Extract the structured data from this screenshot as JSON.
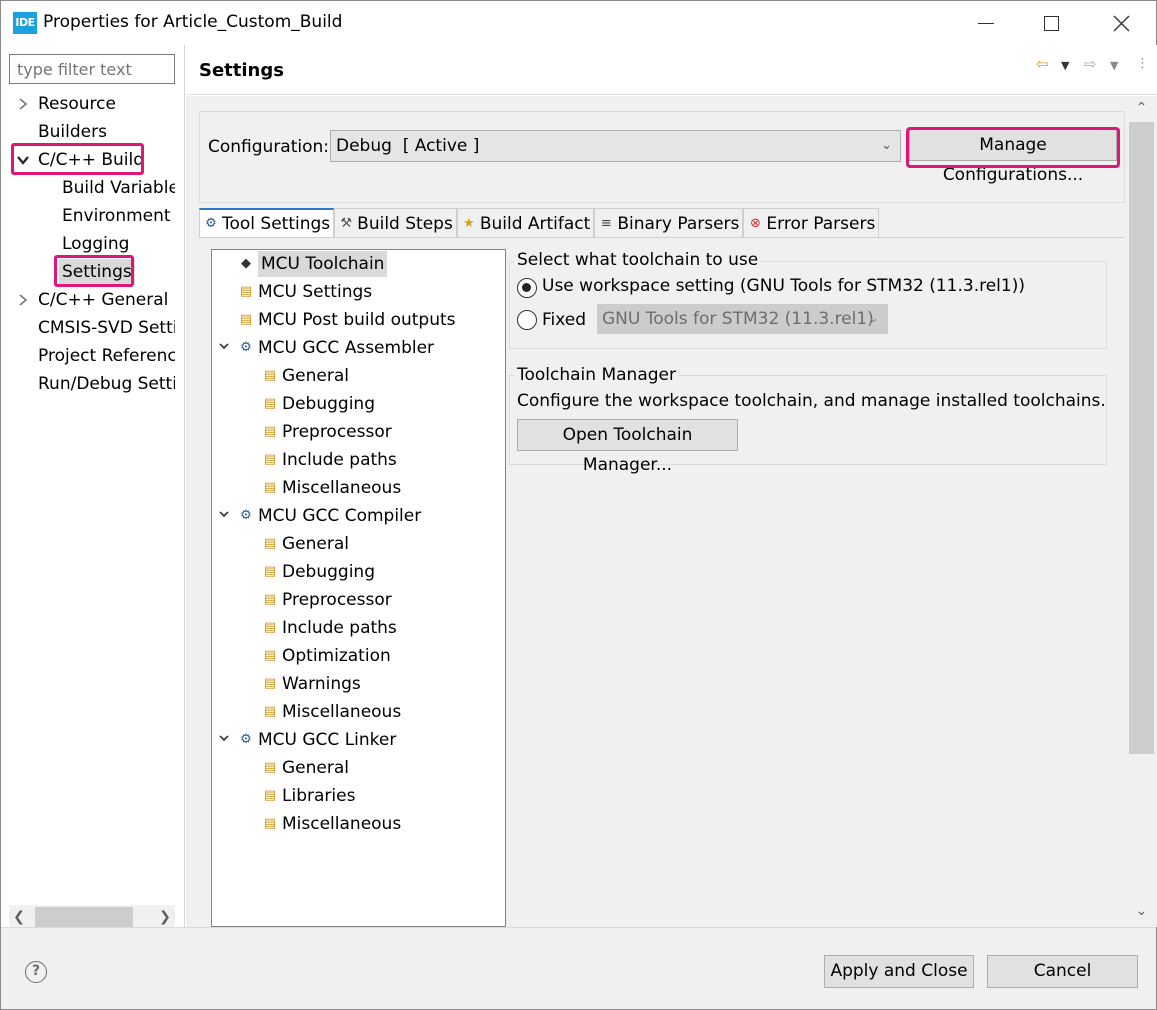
{
  "window": {
    "app_icon": "IDE",
    "title": "Properties for Article_Custom_Build",
    "icons": [
      "minimize-icon",
      "maximize-icon",
      "close-icon"
    ]
  },
  "nav": {
    "filter_placeholder": "type filter text",
    "items": [
      {
        "label": "Resource",
        "twisty": "collapsed"
      },
      {
        "label": "Builders"
      },
      {
        "label": "C/C++ Build",
        "twisty": "expanded",
        "highlighted": true
      },
      {
        "label": "Build Variables"
      },
      {
        "label": "Environment"
      },
      {
        "label": "Logging"
      },
      {
        "label": "Settings",
        "selected": true,
        "highlighted": true
      },
      {
        "label": "C/C++ General",
        "twisty": "collapsed"
      },
      {
        "label": "CMSIS-SVD Settings"
      },
      {
        "label": "Project References"
      },
      {
        "label": "Run/Debug Settings"
      }
    ]
  },
  "panel": {
    "title": "Settings",
    "configuration_label": "Configuration:",
    "configuration_value": "Debug  [ Active ]",
    "manage_button": "Manage Configurations..."
  },
  "tabs": [
    {
      "label": "Tool Settings",
      "icon": "gear-icon",
      "active": true
    },
    {
      "label": "Build Steps",
      "icon": "hammer-icon"
    },
    {
      "label": "Build Artifact",
      "icon": "trophy-icon"
    },
    {
      "label": "Binary Parsers",
      "icon": "binary-icon"
    },
    {
      "label": "Error Parsers",
      "icon": "error-icon"
    }
  ],
  "tree": [
    {
      "label": "MCU Toolchain",
      "level": 0,
      "icon": "chip",
      "selected": true
    },
    {
      "label": "MCU Settings",
      "level": 0,
      "icon": "folder"
    },
    {
      "label": "MCU Post build outputs",
      "level": 0,
      "icon": "folder"
    },
    {
      "label": "MCU GCC Assembler",
      "level": 0,
      "icon": "gear",
      "twisty": "expanded"
    },
    {
      "label": "General",
      "level": 1,
      "icon": "folder"
    },
    {
      "label": "Debugging",
      "level": 1,
      "icon": "folder"
    },
    {
      "label": "Preprocessor",
      "level": 1,
      "icon": "folder"
    },
    {
      "label": "Include paths",
      "level": 1,
      "icon": "folder"
    },
    {
      "label": "Miscellaneous",
      "level": 1,
      "icon": "folder"
    },
    {
      "label": "MCU GCC Compiler",
      "level": 0,
      "icon": "gear",
      "twisty": "expanded"
    },
    {
      "label": "General",
      "level": 1,
      "icon": "folder"
    },
    {
      "label": "Debugging",
      "level": 1,
      "icon": "folder"
    },
    {
      "label": "Preprocessor",
      "level": 1,
      "icon": "folder"
    },
    {
      "label": "Include paths",
      "level": 1,
      "icon": "folder"
    },
    {
      "label": "Optimization",
      "level": 1,
      "icon": "folder"
    },
    {
      "label": "Warnings",
      "level": 1,
      "icon": "folder"
    },
    {
      "label": "Miscellaneous",
      "level": 1,
      "icon": "folder"
    },
    {
      "label": "MCU GCC Linker",
      "level": 0,
      "icon": "gear",
      "twisty": "expanded"
    },
    {
      "label": "General",
      "level": 1,
      "icon": "folder"
    },
    {
      "label": "Libraries",
      "level": 1,
      "icon": "folder"
    },
    {
      "label": "Miscellaneous",
      "level": 1,
      "icon": "folder"
    }
  ],
  "toolchain_select": {
    "title": "Select what toolchain to use",
    "option_workspace": "Use workspace setting (GNU Tools for STM32 (11.3.rel1))",
    "option_fixed": "Fixed",
    "fixed_value": "GNU Tools for STM32 (11.3.rel1)",
    "selected": "workspace"
  },
  "toolchain_manager": {
    "title": "Toolchain Manager",
    "description": "Configure the workspace toolchain, and manage installed toolchains.",
    "button": "Open Toolchain Manager..."
  },
  "footer": {
    "help_icon": "?",
    "apply": "Apply and Close",
    "cancel": "Cancel"
  },
  "colors": {
    "highlight": "#e0157a",
    "app_icon": "#1ba1e2",
    "active_tab": "#2b79c2"
  }
}
